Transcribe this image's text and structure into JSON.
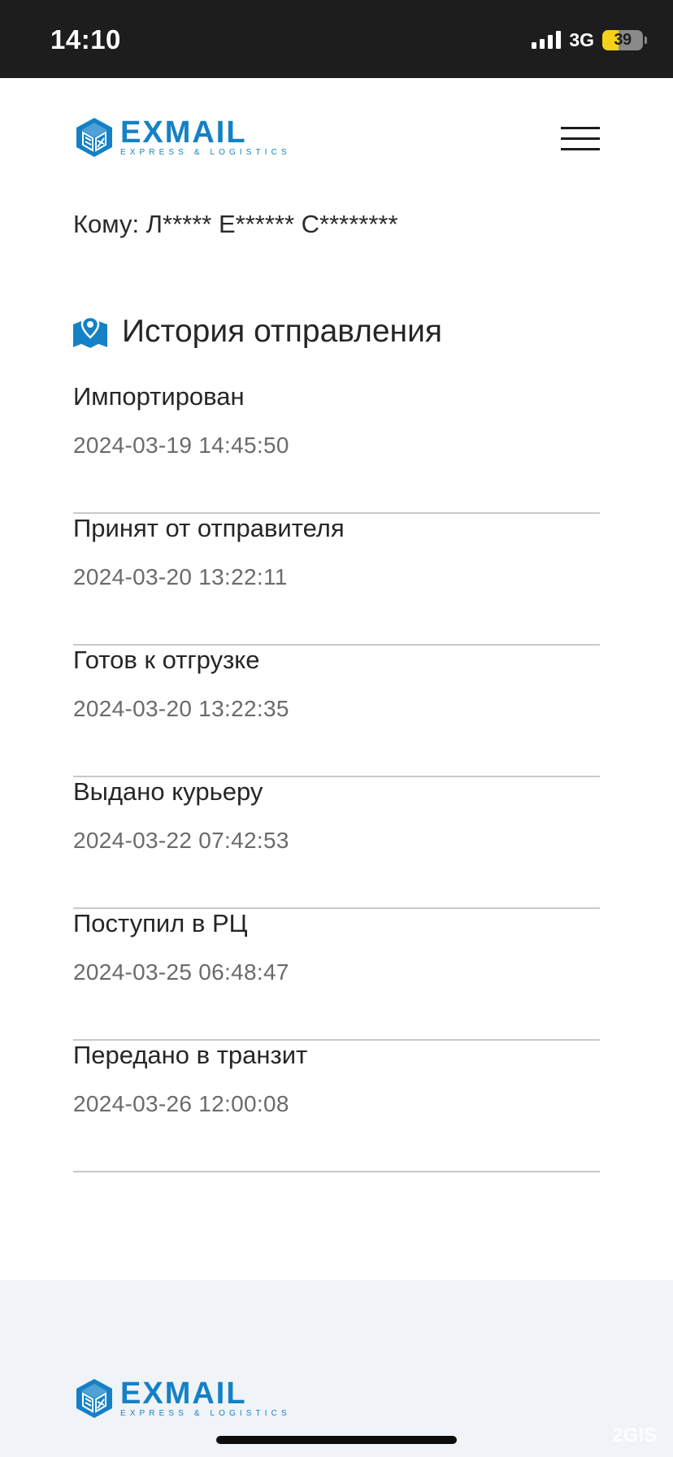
{
  "status_bar": {
    "time": "14:10",
    "network": "3G",
    "battery_level": "39",
    "battery_fraction": 0.39
  },
  "brand": {
    "name": "EXMAIL",
    "tagline": "EXPRESS & LOGISTICS",
    "color": "#1481c6"
  },
  "recipient": {
    "text": "Кому: Л***** Е****** С********"
  },
  "history": {
    "title": "История отправления",
    "icon": "map-pin-icon",
    "events": [
      {
        "status": "Импортирован",
        "time": "2024-03-19 14:45:50"
      },
      {
        "status": "Принят от отправителя",
        "time": "2024-03-20 13:22:11"
      },
      {
        "status": "Готов к отгрузке",
        "time": "2024-03-20 13:22:35"
      },
      {
        "status": "Выдано курьеру",
        "time": "2024-03-22 07:42:53"
      },
      {
        "status": "Поступил в РЦ",
        "time": "2024-03-25 06:48:47"
      },
      {
        "status": "Передано в транзит",
        "time": "2024-03-26 12:00:08"
      }
    ]
  },
  "footer": {
    "brand_name": "EXMAIL",
    "brand_tagline": "EXPRESS & LOGISTICS"
  },
  "watermark": "2GIS"
}
